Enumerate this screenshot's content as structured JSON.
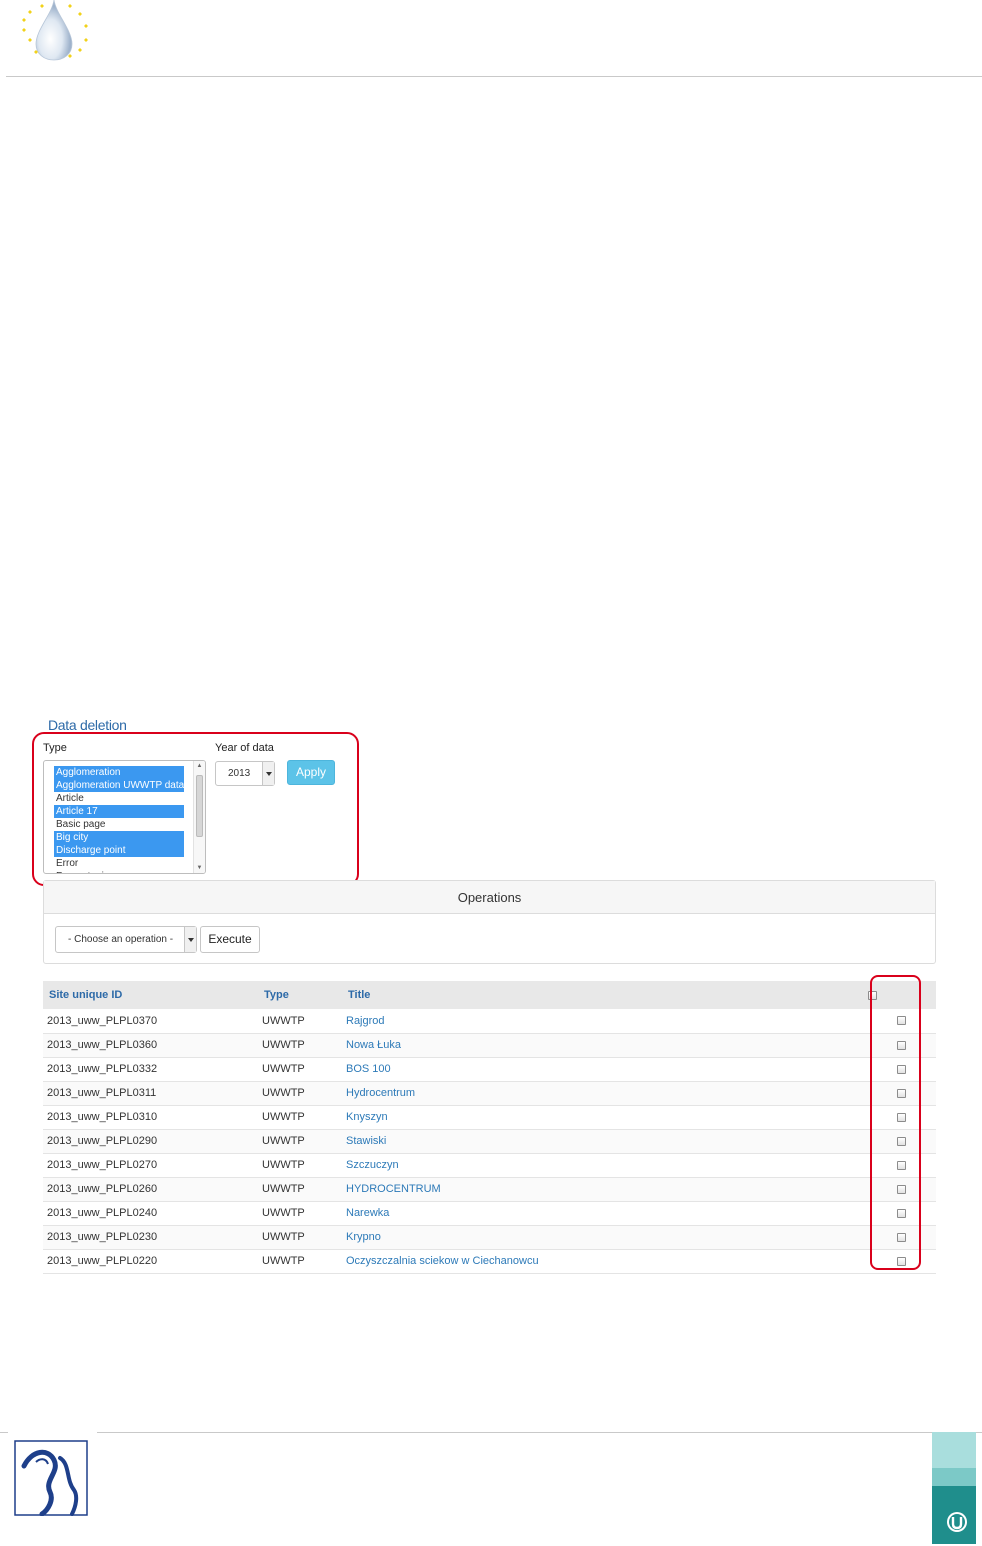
{
  "section": {
    "title": "Data deletion"
  },
  "filters": {
    "type_label": "Type",
    "type_options": [
      {
        "label": "Agglomeration",
        "selected": true
      },
      {
        "label": "Agglomeration UWWTP data",
        "selected": true
      },
      {
        "label": "Article",
        "selected": false
      },
      {
        "label": "Article 17",
        "selected": true
      },
      {
        "label": "Basic page",
        "selected": false
      },
      {
        "label": "Big city",
        "selected": true
      },
      {
        "label": "Discharge point",
        "selected": true
      },
      {
        "label": "Error",
        "selected": false
      },
      {
        "label": "Forum topic",
        "selected": false
      }
    ],
    "year_label": "Year of data",
    "year_value": "2013",
    "apply_label": "Apply"
  },
  "operations": {
    "title": "Operations",
    "select_value": "- Choose an operation -",
    "execute_label": "Execute"
  },
  "table": {
    "headers": {
      "site_id": "Site unique ID",
      "type": "Type",
      "title": "Title"
    },
    "rows": [
      {
        "site_id": "2013_uww_PLPL0370",
        "type": "UWWTP",
        "title": "Rajgrod"
      },
      {
        "site_id": "2013_uww_PLPL0360",
        "type": "UWWTP",
        "title": "Nowa Łuka"
      },
      {
        "site_id": "2013_uww_PLPL0332",
        "type": "UWWTP",
        "title": "BOS 100"
      },
      {
        "site_id": "2013_uww_PLPL0311",
        "type": "UWWTP",
        "title": "Hydrocentrum"
      },
      {
        "site_id": "2013_uww_PLPL0310",
        "type": "UWWTP",
        "title": "Knyszyn"
      },
      {
        "site_id": "2013_uww_PLPL0290",
        "type": "UWWTP",
        "title": "Stawiski"
      },
      {
        "site_id": "2013_uww_PLPL0270",
        "type": "UWWTP",
        "title": "Szczuczyn"
      },
      {
        "site_id": "2013_uww_PLPL0260",
        "type": "UWWTP",
        "title": "HYDROCENTRUM"
      },
      {
        "site_id": "2013_uww_PLPL0240",
        "type": "UWWTP",
        "title": "Narewka"
      },
      {
        "site_id": "2013_uww_PLPL0230",
        "type": "UWWTP",
        "title": "Krypno"
      },
      {
        "site_id": "2013_uww_PLPL0220",
        "type": "UWWTP",
        "title": "Oczyszczalnia sciekow w Ciechanowcu"
      }
    ]
  },
  "colors": {
    "accent": "#2d6aa8",
    "selection": "#3b98f0",
    "apply_button": "#5cc3e8",
    "highlight": "#d9001b",
    "footer_badge_light": "#a9dedd",
    "footer_badge_dark": "#1f8e8c"
  },
  "icons": {
    "header_logo": "water-drop-eu-stars-icon",
    "footer_logo": "river-shape-logo-icon",
    "footer_badge": "u-badge-icon"
  }
}
